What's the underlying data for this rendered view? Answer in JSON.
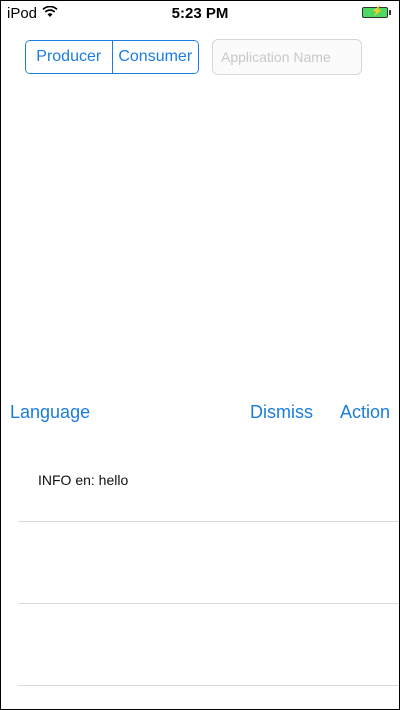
{
  "status_bar": {
    "carrier": "iPod",
    "time": "5:23 PM",
    "wifi_icon": "wifi-icon",
    "battery_icon": "battery-charging-icon",
    "battery_color": "#4cd964"
  },
  "mode_switch": {
    "segments": [
      "Producer",
      "Consumer"
    ],
    "accent_color": "#1a7de0"
  },
  "application_name": {
    "placeholder": "Application Name",
    "value": ""
  },
  "toolbar": {
    "language_label": "Language",
    "dismiss_label": "Dismiss",
    "action_label": "Action"
  },
  "log": {
    "rows": [
      "INFO en: hello",
      "",
      ""
    ]
  }
}
